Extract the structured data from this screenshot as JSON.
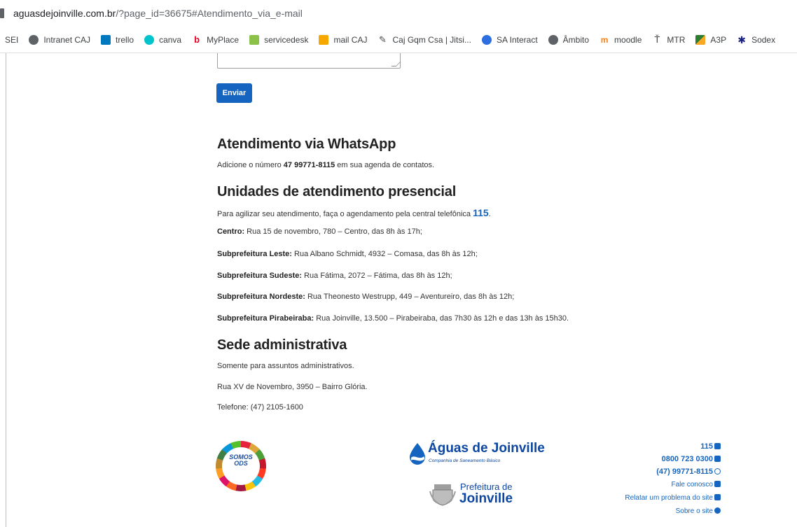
{
  "browser": {
    "url_domain": "aguasdejoinville.com.br",
    "url_rest": "/?page_id=36675#Atendimento_via_e-mail",
    "bookmarks": [
      {
        "label": "SEI",
        "icon": "none"
      },
      {
        "label": "Intranet CAJ",
        "icon": "globe-icon"
      },
      {
        "label": "trello",
        "icon": "trello-icon"
      },
      {
        "label": "canva",
        "icon": "canva-icon"
      },
      {
        "label": "MyPlace",
        "icon": "myplace-icon"
      },
      {
        "label": "servicedesk",
        "icon": "servicedesk-icon"
      },
      {
        "label": "mail CAJ",
        "icon": "mail-icon"
      },
      {
        "label": "Caj Gqm Csa | Jitsi...",
        "icon": "jitsi-icon"
      },
      {
        "label": "SA Interact",
        "icon": "sa-interact-icon"
      },
      {
        "label": "Âmbito",
        "icon": "globe-icon"
      },
      {
        "label": "moodle",
        "icon": "moodle-icon"
      },
      {
        "label": "MTR",
        "icon": "mtr-icon"
      },
      {
        "label": "A3P",
        "icon": "a3p-icon"
      },
      {
        "label": "Sodex",
        "icon": "sodexo-icon"
      }
    ]
  },
  "form": {
    "send_label": "Enviar"
  },
  "whatsapp": {
    "title": "Atendimento via WhatsApp",
    "text_before": "Adicione o número ",
    "number": "47 99771-8115",
    "text_after": " em sua agenda de contatos."
  },
  "units": {
    "title": "Unidades de atendimento presencial",
    "intro": "Para agilizar seu atendimento, faça o agendamento pela central telefônica ",
    "intro_number": "115",
    "intro_end": ".",
    "items": [
      {
        "name": "Centro:",
        "detail": " Rua 15 de novembro, 780 – Centro, das 8h às 17h;"
      },
      {
        "name": "Subprefeitura Leste:",
        "detail": " Rua Albano Schmidt, 4932 – Comasa, das 8h às 12h;"
      },
      {
        "name": "Subprefeitura Sudeste:",
        "detail": " Rua Fátima, 2072 – Fátima, das 8h às 12h;"
      },
      {
        "name": "Subprefeitura Nordeste:",
        "detail": " Rua Theonesto Westrupp, 449 – Aventureiro, das 8h às 12h;"
      },
      {
        "name": "Subprefeitura Pirabeiraba:",
        "detail": " Rua Joinville, 13.500 – Pirabeiraba, das 7h30 às 12h e das 13h às 15h30."
      }
    ]
  },
  "sede": {
    "title": "Sede administrativa",
    "lines": [
      "Somente para assuntos administrativos.",
      "Rua XV de Novembro, 3950 – Bairro Glória.",
      "Telefone: (47) 2105-1600"
    ]
  },
  "footer": {
    "ods_line1": "SOMOS",
    "ods_line2": "ODS",
    "aguas_name": "Águas de Joinville",
    "aguas_sub": "Companhia de Saneamento Básico",
    "prefeitura_line1": "Prefeitura de",
    "prefeitura_line2": "Joinville",
    "contacts": [
      {
        "label": "115",
        "icon": "phone-icon"
      },
      {
        "label": "0800 723 0300",
        "icon": "phone-icon"
      },
      {
        "label": "(47) 99771-8115",
        "icon": "whatsapp-icon"
      },
      {
        "label": "Fale conosco",
        "icon": "envelope-icon"
      },
      {
        "label": "Relatar um problema do site",
        "icon": "warning-icon"
      },
      {
        "label": "Sobre o site",
        "icon": "info-icon"
      }
    ]
  },
  "colors": {
    "primary": "#1565c0",
    "heading": "#222222",
    "text": "#333333"
  }
}
